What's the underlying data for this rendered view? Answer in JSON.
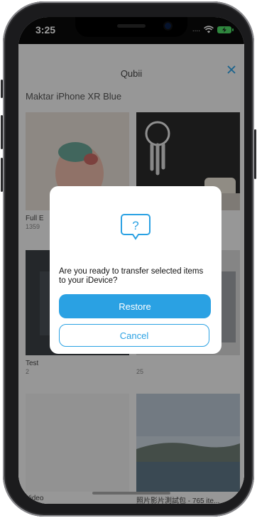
{
  "status_bar": {
    "time": "3:25",
    "signal_dots": "....",
    "wifi_icon": "wifi-icon",
    "battery_icon": "battery-charging-icon"
  },
  "header": {
    "title": "Qubii",
    "close_icon": "close-icon"
  },
  "device": {
    "name": "Maktar iPhone XR Blue"
  },
  "albums": [
    {
      "label": "Full E",
      "count": "1359"
    },
    {
      "label": "",
      "count": ""
    },
    {
      "label": "Test",
      "count": "2"
    },
    {
      "label": "",
      "count": "25"
    },
    {
      "label": "Video",
      "count": ""
    },
    {
      "label": "照片影片測試包 - 765 ite...",
      "count": "765"
    }
  ],
  "dialog": {
    "icon": "question-bubble-icon",
    "message": "Are you ready to transfer selected items to your iDevice?",
    "restore_label": "Restore",
    "cancel_label": "Cancel"
  },
  "colors": {
    "accent": "#2aa1e3",
    "status_bar": "#0a0a0a",
    "battery": "#4cd964"
  }
}
